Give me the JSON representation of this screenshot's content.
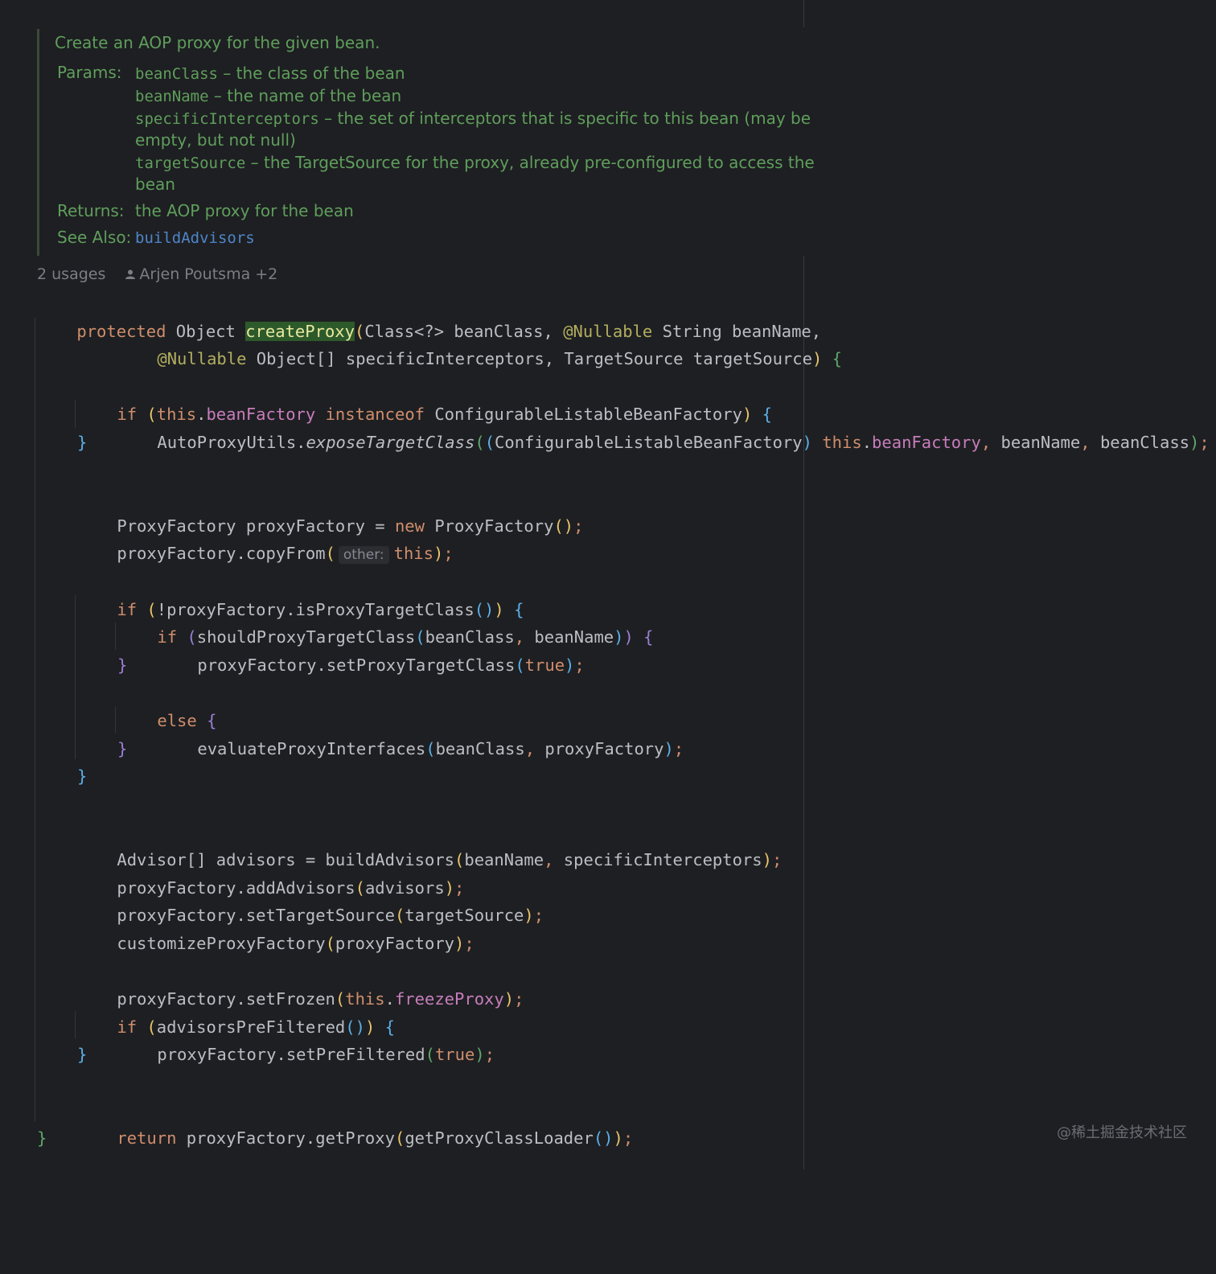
{
  "javadoc": {
    "summary": "Create an AOP proxy for the given bean.",
    "params_label": "Params:",
    "params": [
      {
        "name": "beanClass",
        "desc": " – the class of the bean"
      },
      {
        "name": "beanName",
        "desc": " – the name of the bean"
      },
      {
        "name": "specificInterceptors",
        "desc": " – the set of interceptors that is specific to this bean (may be",
        "cont": "empty, but not null)"
      },
      {
        "name": "targetSource",
        "desc": " – the TargetSource for the proxy, already pre-configured to access the",
        "cont": "bean"
      }
    ],
    "returns_label": "Returns:",
    "returns": "the AOP proxy for the bean",
    "see_also_label": "See Also:",
    "see_also": "buildAdvisors"
  },
  "inlay": {
    "usages": "2 usages",
    "authors": "Arjen Poutsma +2",
    "hint_other": "other:"
  },
  "code": {
    "signature": {
      "kw_protected": "protected",
      "ret": " Object ",
      "method": "createProxy",
      "p_open": "(",
      "p1": "Class<?> beanClass",
      "comma": ", ",
      "nullable1": "@Nullable",
      "p2": " String beanName,",
      "nullable2": "@Nullable",
      "p3": " Object[] specificInterceptors",
      "p4": "TargetSource targetSource",
      "p_close": ")",
      "open_brace": " {"
    },
    "if1": {
      "kw_if": "if",
      "open": " (",
      "kw_this": "this",
      "dot": ".",
      "field": "beanFactory",
      "kw_instanceof": " instanceof",
      "type": " ConfigurableListableBeanFactory",
      "close": ")",
      "brace": " {"
    },
    "expose": {
      "obj": "AutoProxyUtils.",
      "method": "exposeTargetClass",
      "open": "(",
      "cast_open": "(",
      "cast": "ConfigurableListableBeanFactory",
      "cast_close": ")",
      "kw_this": " this",
      "dot": ".",
      "field": "beanFactory",
      "comma1": ", ",
      "a2": "beanName",
      "comma2": ", ",
      "a3": "beanClass",
      "close": ")",
      "semi": ";"
    },
    "close_brace": "}",
    "open_brace": " {",
    "else_kw": "else",
    "decl_pf": {
      "lhs": "ProxyFactory proxyFactory = ",
      "kw_new": "new",
      "rhs": " ProxyFactory",
      "parens": "()",
      "semi": ";"
    },
    "copy_from": {
      "call": "proxyFactory.copyFrom",
      "open": "(",
      "kw_this": "this",
      "close": ")",
      "semi": ";"
    },
    "if2": {
      "kw_if": "if",
      "open": " (",
      "call": "!proxyFactory.isProxyTargetClass",
      "parens": "()",
      "close": ")"
    },
    "if3": {
      "kw_if": "if",
      "open": " (",
      "call": "shouldProxyTargetClass",
      "p_open": "(",
      "args": "beanClass",
      "comma": ", ",
      "arg2": "beanName",
      "p_close": ")",
      "close": ")"
    },
    "set_ptc": {
      "call": "proxyFactory.setProxyTargetClass",
      "open": "(",
      "kw_true": "true",
      "close": ")",
      "semi": ";"
    },
    "eval": {
      "call": "evaluateProxyInterfaces",
      "open": "(",
      "a1": "beanClass",
      "comma": ", ",
      "a2": "proxyFactory",
      "close": ")",
      "semi": ";"
    },
    "advisors": {
      "lhs": "Advisor[] advisors = buildAdvisors",
      "open": "(",
      "a1": "beanName",
      "comma": ", ",
      "a2": "specificInterceptors",
      "close": ")",
      "semi": ";"
    },
    "add_adv": {
      "call": "proxyFactory.addAdvisors",
      "open": "(",
      "arg": "advisors",
      "close": ")",
      "semi": ";"
    },
    "set_ts": {
      "call": "proxyFactory.setTargetSource",
      "open": "(",
      "arg": "targetSource",
      "close": ")",
      "semi": ";"
    },
    "customize": {
      "call": "customizeProxyFactory",
      "open": "(",
      "arg": "proxyFactory",
      "close": ")",
      "semi": ";"
    },
    "set_frozen": {
      "call": "proxyFactory.setFrozen",
      "open": "(",
      "kw_this": "this",
      "dot": ".",
      "field": "freezeProxy",
      "close": ")",
      "semi": ";"
    },
    "if4": {
      "kw_if": "if",
      "open": " (",
      "call": "advisorsPreFiltered",
      "parens": "()",
      "close": ")"
    },
    "set_pf": {
      "call": "proxyFactory.setPreFiltered",
      "open": "(",
      "kw_true": "true",
      "close": ")",
      "semi": ";"
    },
    "ret": {
      "kw_return": "return",
      "call": " proxyFactory.getProxy",
      "open": "(",
      "inner": "getProxyClassLoader",
      "parens": "()",
      "close": ")",
      "semi": ";"
    }
  },
  "watermark": "@稀土掘金技术社区",
  "colors": {
    "background": "#1e1f22",
    "keyword": "#cf8e6d",
    "field": "#c77dbb",
    "annotation": "#b3ae60",
    "doc_comment": "#5f9e5c",
    "doc_link": "#4e85c9",
    "default_text": "#bcbec4"
  }
}
